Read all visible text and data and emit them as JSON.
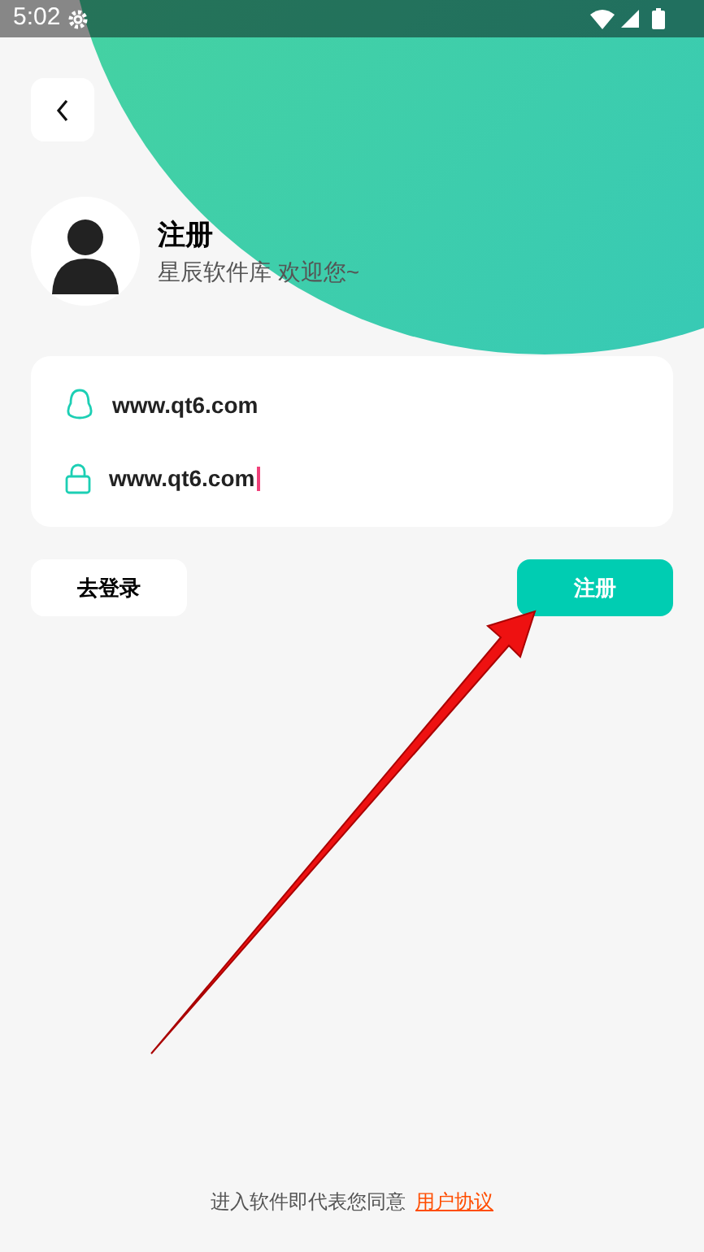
{
  "status_bar": {
    "time": "5:02"
  },
  "header": {
    "title": "注册",
    "subtitle": "星辰软件库 欢迎您~"
  },
  "fields": [
    {
      "kind": "account",
      "value": "www.qt6.com",
      "focused": false
    },
    {
      "kind": "password",
      "value": "www.qt6.com",
      "focused": true
    }
  ],
  "buttons": [
    {
      "label": "去登录",
      "kind": "secondary"
    },
    {
      "label": "注册",
      "kind": "primary"
    }
  ],
  "footer": {
    "text": "进入软件即代表您同意",
    "link": "用户协议"
  }
}
